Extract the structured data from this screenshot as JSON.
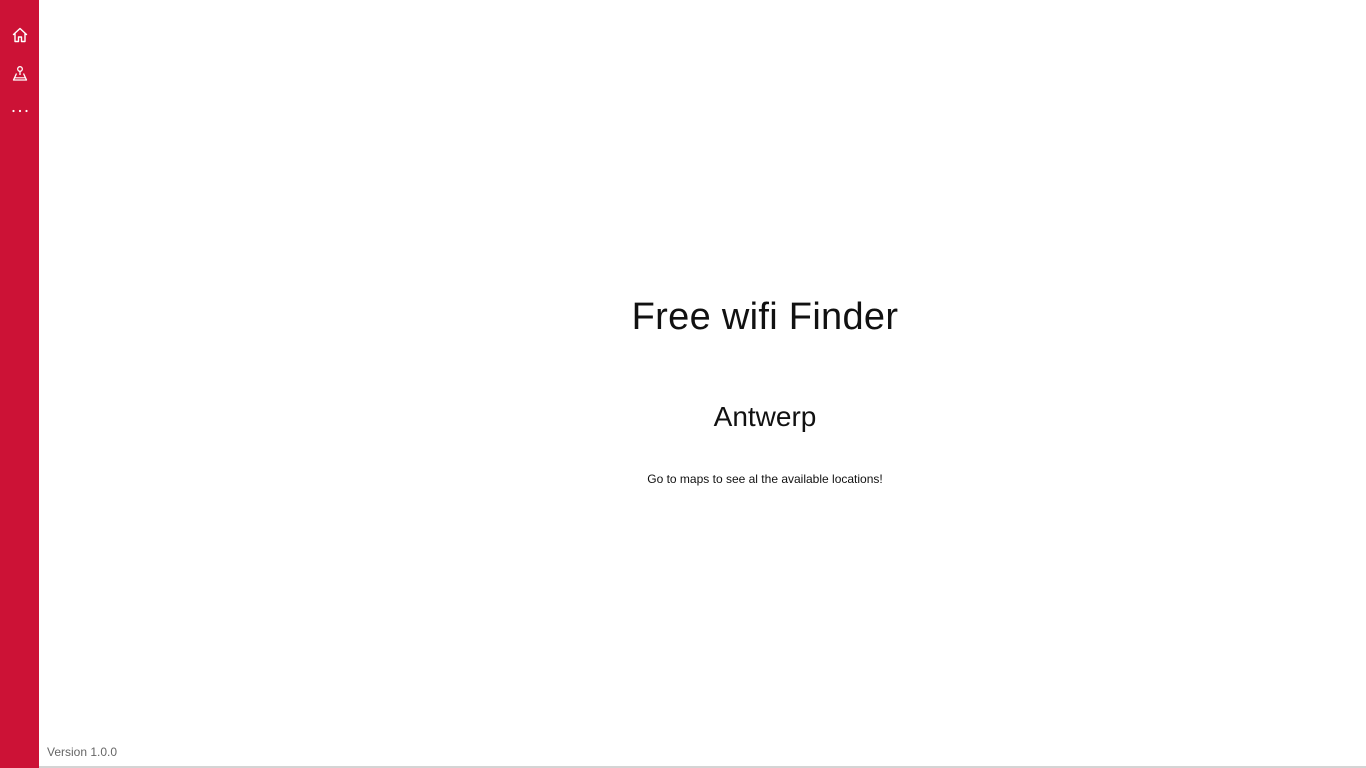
{
  "theme": {
    "accent": "#cc1236",
    "icon_color": "#ffffff",
    "text_color": "#111111",
    "muted_text": "#666666"
  },
  "sidebar": {
    "items": [
      {
        "name": "home",
        "icon": "home-icon"
      },
      {
        "name": "map",
        "icon": "map-pin-icon"
      },
      {
        "name": "more",
        "icon": "more-icon"
      }
    ]
  },
  "main": {
    "title": "Free wifi Finder",
    "subtitle": "Antwerp",
    "message": "Go to maps to see al the available locations!"
  },
  "footer": {
    "version": "Version 1.0.0"
  }
}
